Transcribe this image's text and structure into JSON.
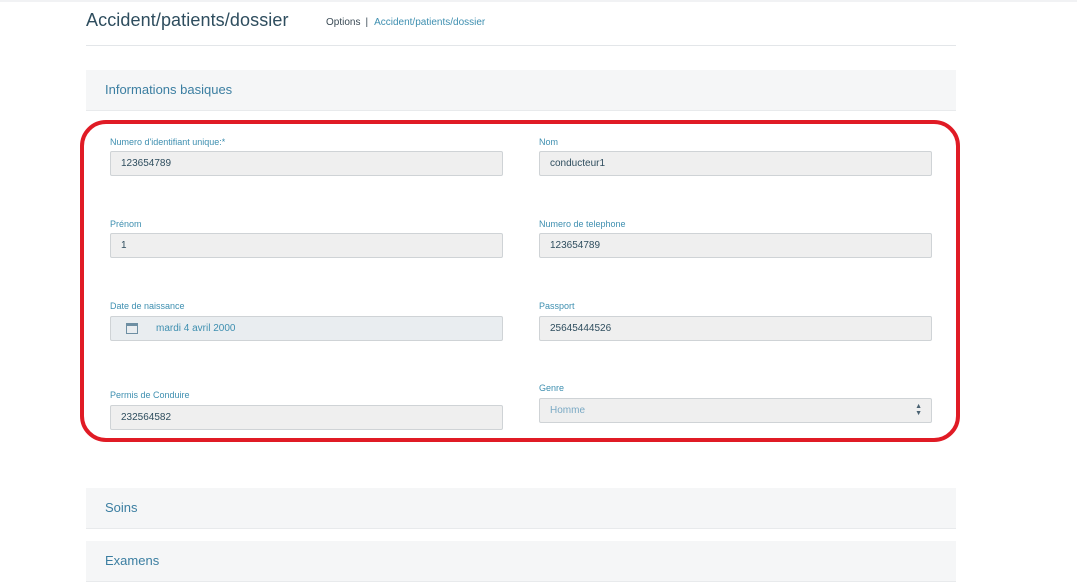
{
  "header": {
    "title": "Accident/patients/dossier",
    "breadcrumb": {
      "options": "Options",
      "separator": "|",
      "current": "Accident/patients/dossier"
    }
  },
  "sections": {
    "basic_info": "Informations basiques",
    "soins": "Soins",
    "examens": "Examens"
  },
  "form": {
    "id_label": "Numero d'identifiant unique:*",
    "id_value": "123654789",
    "nom_label": "Nom",
    "nom_value": "conducteur1",
    "prenom_label": "Prénom",
    "prenom_value": "1",
    "phone_label": "Numero de telephone",
    "phone_value": "123654789",
    "dob_label": "Date de naissance",
    "dob_value": "mardi 4 avril 2000",
    "passport_label": "Passport",
    "passport_value": "25645444526",
    "permis_label": "Permis de Conduire",
    "permis_value": "232564582",
    "genre_label": "Genre",
    "genre_value": "Homme"
  },
  "colors": {
    "highlight": "#e01b25",
    "accent": "#3e8fb0",
    "title": "#2e4d5e"
  },
  "icons": {
    "date": "calendar-icon",
    "select": "sort-arrows-icon"
  }
}
